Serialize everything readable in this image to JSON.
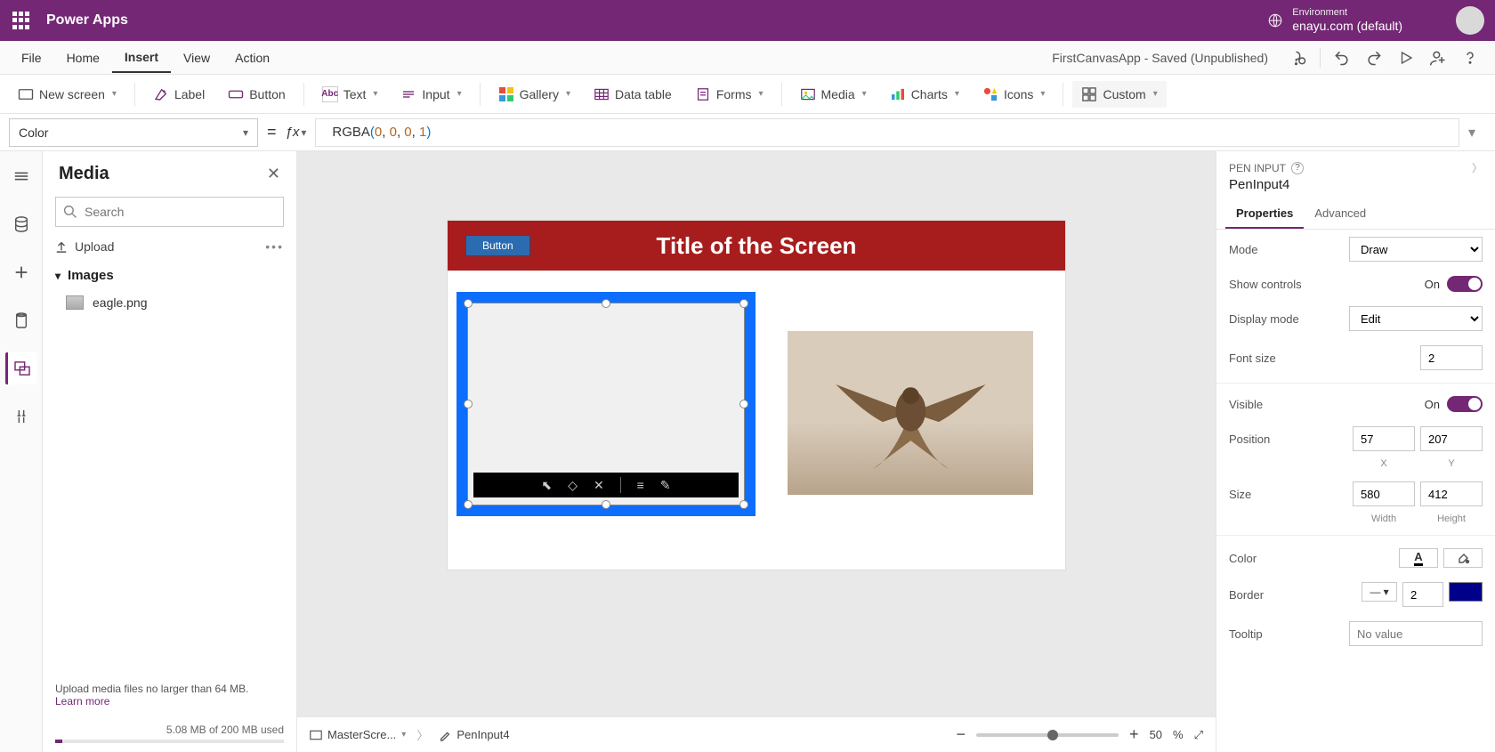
{
  "titlebar": {
    "app_name": "Power Apps",
    "env_label": "Environment",
    "env_name": "enayu.com (default)"
  },
  "menubar": {
    "items": [
      "File",
      "Home",
      "Insert",
      "View",
      "Action"
    ],
    "active_index": 2,
    "doc_status": "FirstCanvasApp - Saved (Unpublished)"
  },
  "ribbon": {
    "new_screen": "New screen",
    "label": "Label",
    "button": "Button",
    "text": "Text",
    "input": "Input",
    "gallery": "Gallery",
    "data_table": "Data table",
    "forms": "Forms",
    "media": "Media",
    "charts": "Charts",
    "icons": "Icons",
    "custom": "Custom"
  },
  "fxbar": {
    "property": "Color",
    "formula_html": "RGBA(0, 0, 0, 1)"
  },
  "mediapanel": {
    "title": "Media",
    "search_placeholder": "Search",
    "upload": "Upload",
    "section_images": "Images",
    "file1": "eagle.png",
    "upload_hint": "Upload media files no larger than 64 MB.",
    "learn_more": "Learn more",
    "usage": "5.08 MB of 200 MB used"
  },
  "canvas": {
    "screen_title": "Title of the Screen",
    "button_label": "Button"
  },
  "statusbar": {
    "crumb1": "MasterScre...",
    "crumb2": "PenInput4",
    "zoom_pct": "50",
    "zoom_unit": "%"
  },
  "props": {
    "control_type": "PEN INPUT",
    "control_name": "PenInput4",
    "tabs": {
      "properties": "Properties",
      "advanced": "Advanced"
    },
    "mode_label": "Mode",
    "mode_value": "Draw",
    "show_controls_label": "Show controls",
    "show_controls_value": "On",
    "display_mode_label": "Display mode",
    "display_mode_value": "Edit",
    "font_size_label": "Font size",
    "font_size_value": "2",
    "visible_label": "Visible",
    "visible_value": "On",
    "position_label": "Position",
    "pos_x": "57",
    "pos_y": "207",
    "pos_xl": "X",
    "pos_yl": "Y",
    "size_label": "Size",
    "size_w": "580",
    "size_h": "412",
    "size_wl": "Width",
    "size_hl": "Height",
    "color_label": "Color",
    "border_label": "Border",
    "border_value": "2",
    "tooltip_label": "Tooltip",
    "tooltip_placeholder": "No value"
  }
}
